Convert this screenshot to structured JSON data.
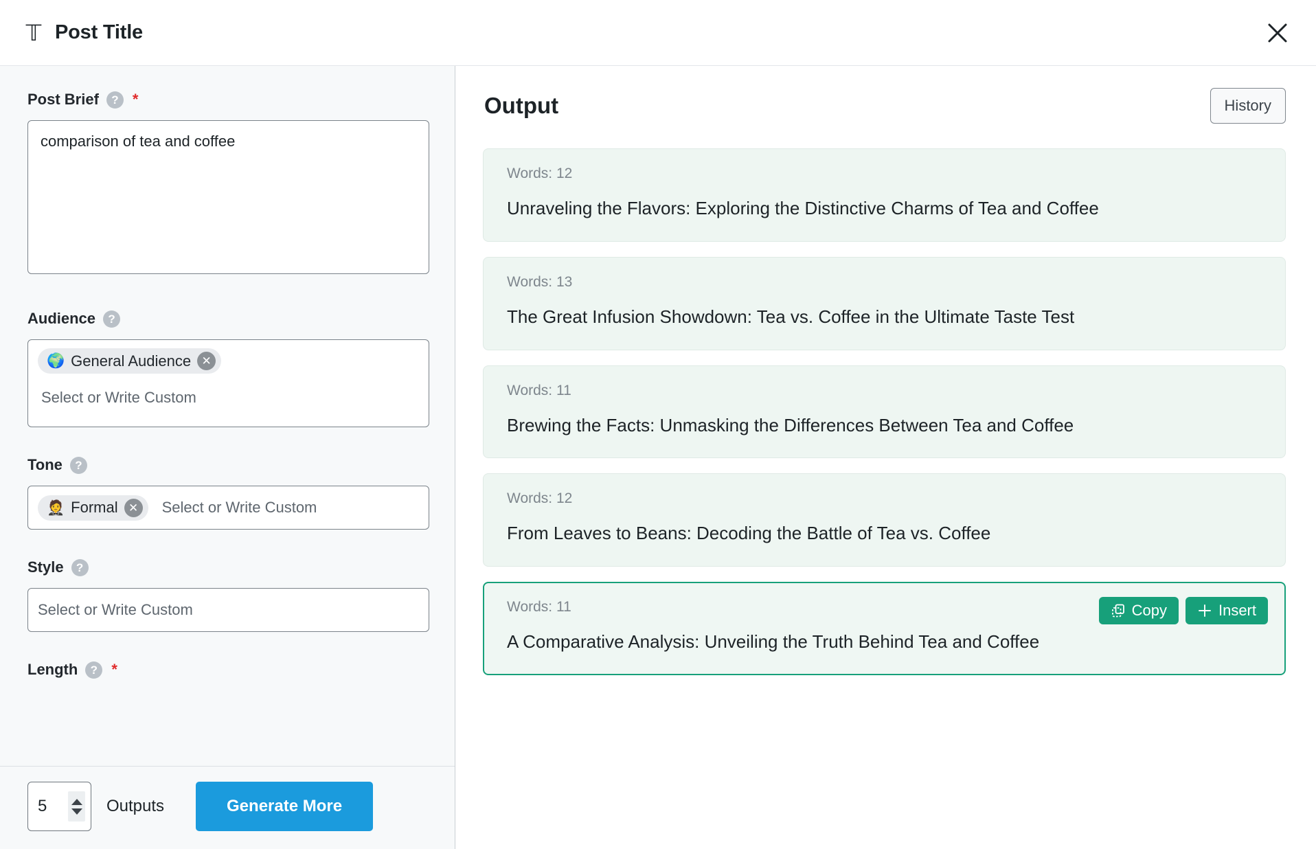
{
  "header": {
    "icon": "title-text-icon",
    "title": "Post Title",
    "close_icon": "close-icon"
  },
  "sidebar": {
    "post_brief": {
      "label": "Post Brief",
      "help_icon": "help-circle-icon",
      "required_marker": "*",
      "value": "comparison of tea and coffee"
    },
    "audience": {
      "label": "Audience",
      "help_icon": "help-circle-icon",
      "chips": [
        {
          "emoji": "🌍",
          "label": "General Audience",
          "remove_icon": "close-circle-icon"
        }
      ],
      "placeholder": "Select or Write Custom"
    },
    "tone": {
      "label": "Tone",
      "help_icon": "help-circle-icon",
      "chips": [
        {
          "emoji": "🤵",
          "label": "Formal",
          "remove_icon": "close-circle-icon"
        }
      ],
      "placeholder": "Select or Write Custom"
    },
    "style": {
      "label": "Style",
      "help_icon": "help-circle-icon",
      "placeholder": "Select or Write Custom"
    },
    "length": {
      "label": "Length",
      "help_icon": "help-circle-icon",
      "required_marker": "*"
    },
    "footer": {
      "outputs_count": "5",
      "outputs_label": "Outputs",
      "generate_label": "Generate More",
      "generate_color": "#1b9bdd",
      "stepper_up_icon": "chevron-up-icon",
      "stepper_down_icon": "chevron-down-icon"
    }
  },
  "output": {
    "title": "Output",
    "history_label": "History",
    "accent_color": "#17a07a",
    "card_bg": "#eef6f2",
    "cards": [
      {
        "words_label": "Words: 12",
        "text": "Unraveling the Flavors: Exploring the Distinctive Charms of Tea and Coffee",
        "active": false
      },
      {
        "words_label": "Words: 13",
        "text": "The Great Infusion Showdown: Tea vs. Coffee in the Ultimate Taste Test",
        "active": false
      },
      {
        "words_label": "Words: 11",
        "text": "Brewing the Facts: Unmasking the Differences Between Tea and Coffee",
        "active": false
      },
      {
        "words_label": "Words: 12",
        "text": "From Leaves to Beans: Decoding the Battle of Tea vs. Coffee",
        "active": false
      },
      {
        "words_label": "Words: 11",
        "text": "A Comparative Analysis: Unveiling the Truth Behind Tea and Coffee",
        "active": true,
        "copy_label": "Copy",
        "copy_icon": "copy-icon",
        "insert_label": "Insert",
        "insert_icon": "plus-icon"
      }
    ]
  }
}
